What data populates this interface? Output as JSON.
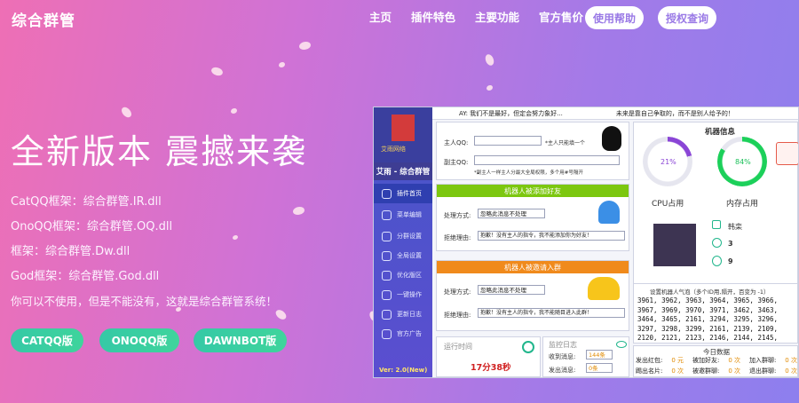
{
  "brand": "综合群管",
  "nav": {
    "items": [
      "主页",
      "插件特色",
      "主要功能",
      "官方售价"
    ],
    "help_button": "使用帮助",
    "license_button": "授权查询"
  },
  "hero": {
    "title": "全新版本 震撼来袭",
    "frameworks": [
      "CatQQ框架：综合群管.IR.dll",
      "OnoQQ框架：综合群管.OQ.dll",
      "框架：综合群管.Dw.dll",
      "God框架：综合群管.God.dll"
    ],
    "tagline": "你可以不使用，但是不能没有，这就是综合群管系统！",
    "buttons": [
      "CATQQ版",
      "ONOQQ版",
      "DAWNBOT版"
    ]
  },
  "app": {
    "brand_name": "艾雨网络",
    "title": "艾雨 - 综合群管",
    "menu": [
      "插件首页",
      "菜单编辑",
      "分群设置",
      "全局设置",
      "优化版区",
      "一键操作",
      "更新日志",
      "官方广告"
    ],
    "version": "Ver: 2.0(New)",
    "marquee_left": "AY: 我们不是最好，但定会努力象好...",
    "marquee_right": "未来是靠自己争取的，而不是别人给予的！",
    "owner_label": "主人QQ:",
    "owner_hint": "*主人只能填一个",
    "vice_label": "副主QQ:",
    "vice_hint": "*副主人一样主人分最大全局权限，多个用#号隔开",
    "friend_bar": "机器人被添加好友",
    "group_bar": "机器人被邀请入群",
    "method_label": "处理方式:",
    "reject_label": "拒绝理由:",
    "method_value": "忽略此消息不处理",
    "friend_reject": "抱歉！没有主人的指令，我不能添加你为好友！",
    "group_reject": "抱歉！没有主人的指令，我不能随目进入此群！",
    "runtime_label": "运行时间",
    "runtime_value": "17分38秒",
    "monitor_label": "监控日志",
    "received_label": "收到消息:",
    "received_value": "144条",
    "sent_label": "发出消息:",
    "sent_value": "0条",
    "robot_info": "机器信息",
    "cpu_value": "21%",
    "cpu_label": "CPU占用",
    "mem_value": "84%",
    "mem_label": "内存占用",
    "cpu_fraction": 0.21,
    "mem_fraction": 0.84,
    "nickname": "韩栾",
    "stat_a": "3",
    "stat_b": "9",
    "popularity": "设置机器人气泡（多个ID用,隔开，百变为 -1）",
    "bubble_ids": [
      "3961, 3962, 3963, 3964, 3965, 3966,",
      "3967, 3969, 3970, 3971, 3462, 3463,",
      "3464, 3465, 2161, 3294, 3295, 3296,",
      "3297, 3298, 3299, 2161, 2139, 2109,",
      "2120, 2121, 2123, 2146, 2144, 2145,"
    ],
    "today": "今日数据",
    "today_rows": [
      [
        "发出红包:",
        "0 元",
        "被加好友:",
        "0 次",
        "加入群聊:",
        "0 次"
      ],
      [
        "踢出名片:",
        "0 次",
        "被邀群聊:",
        "0 次",
        "退出群聊:",
        "0 次"
      ]
    ]
  },
  "colors": {
    "accent": "#9a7ae6",
    "button_green": "#3bcf9f",
    "friend_bar": "#7cc70f",
    "group_bar": "#f08a1c"
  }
}
